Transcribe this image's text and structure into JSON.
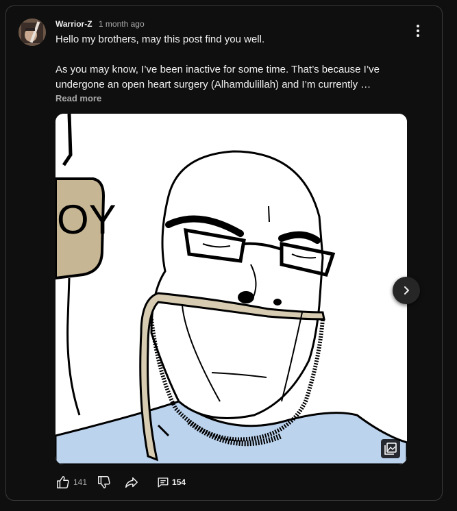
{
  "post": {
    "author": "Warrior-Z",
    "time": "1 month ago",
    "paragraph1": "Hello my brothers, may this post find you well.",
    "paragraph2": "As you may know, I’ve been inactive for some time. That’s because I’ve undergone an open heart surgery (Alhamdulillah) and I’m currently …",
    "read_more": "Read more"
  },
  "image": {
    "sign_text": "OY",
    "skin_color": "#ffffff",
    "tube_color": "#d7ccb2",
    "shirt_color": "#bcd3ee"
  },
  "actions": {
    "likes": "141",
    "comments": "154"
  },
  "colors": {
    "background": "#0f0f0f",
    "text_primary": "#f1f1f1",
    "text_secondary": "#aaaaaa",
    "border": "#3a3a3a"
  }
}
